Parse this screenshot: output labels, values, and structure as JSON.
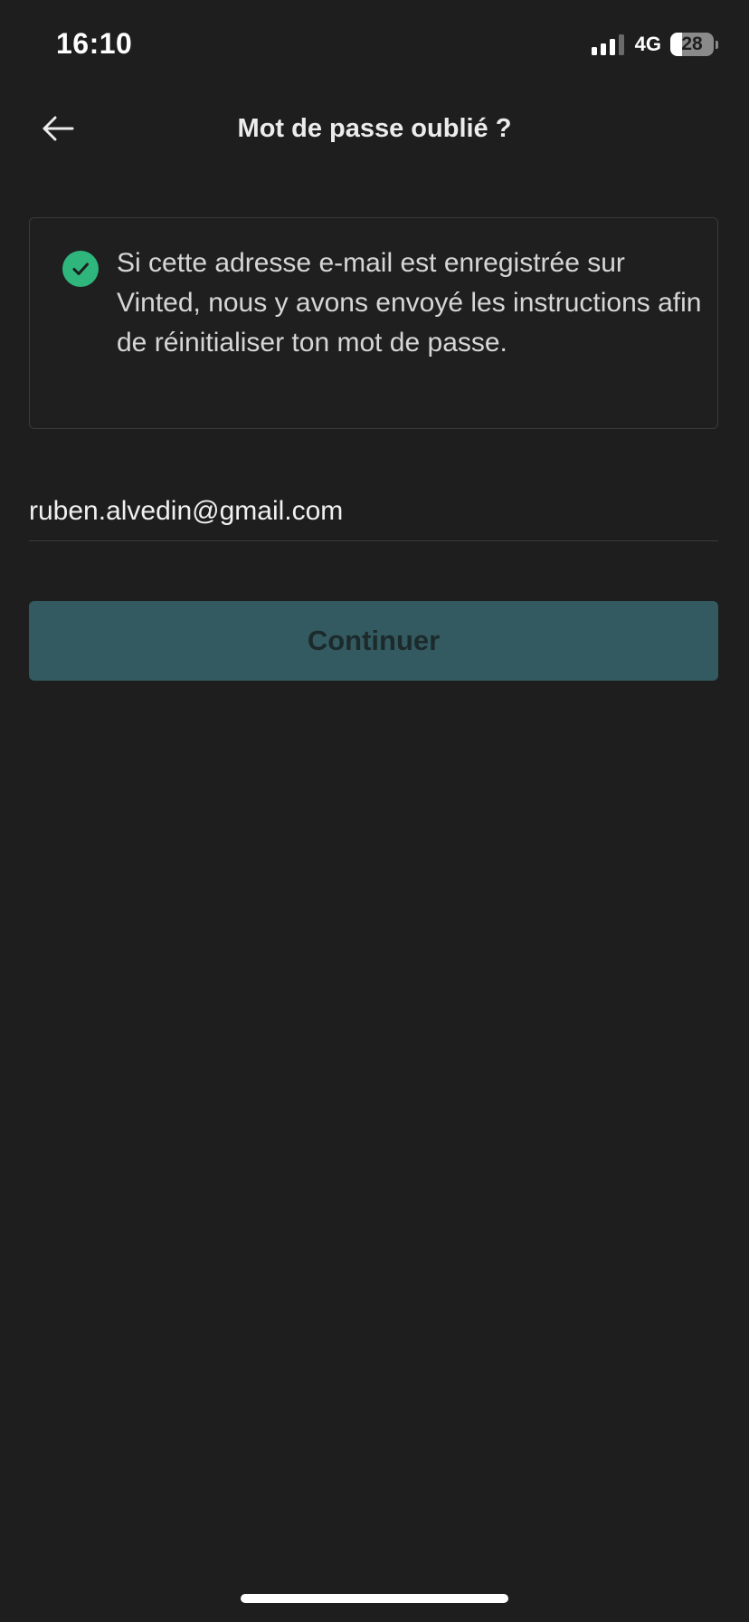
{
  "status_bar": {
    "time": "16:10",
    "network": "4G",
    "battery_level": "28",
    "battery_fraction": 0.28,
    "signal_bars_active": 3,
    "signal_bars_total": 4
  },
  "header": {
    "title": "Mot de passe oublié ?",
    "back_icon": "arrow-left-icon"
  },
  "info_card": {
    "icon": "check-circle-icon",
    "icon_color": "#2eb67d",
    "message": "Si cette adresse e-mail est enregistrée sur Vinted, nous y avons envoyé les instructions afin de réinitialiser ton mot de passe."
  },
  "email_field": {
    "value": "ruben.alvedin@gmail.com"
  },
  "continue_button": {
    "label": "Continuer",
    "background": "#325a60"
  }
}
